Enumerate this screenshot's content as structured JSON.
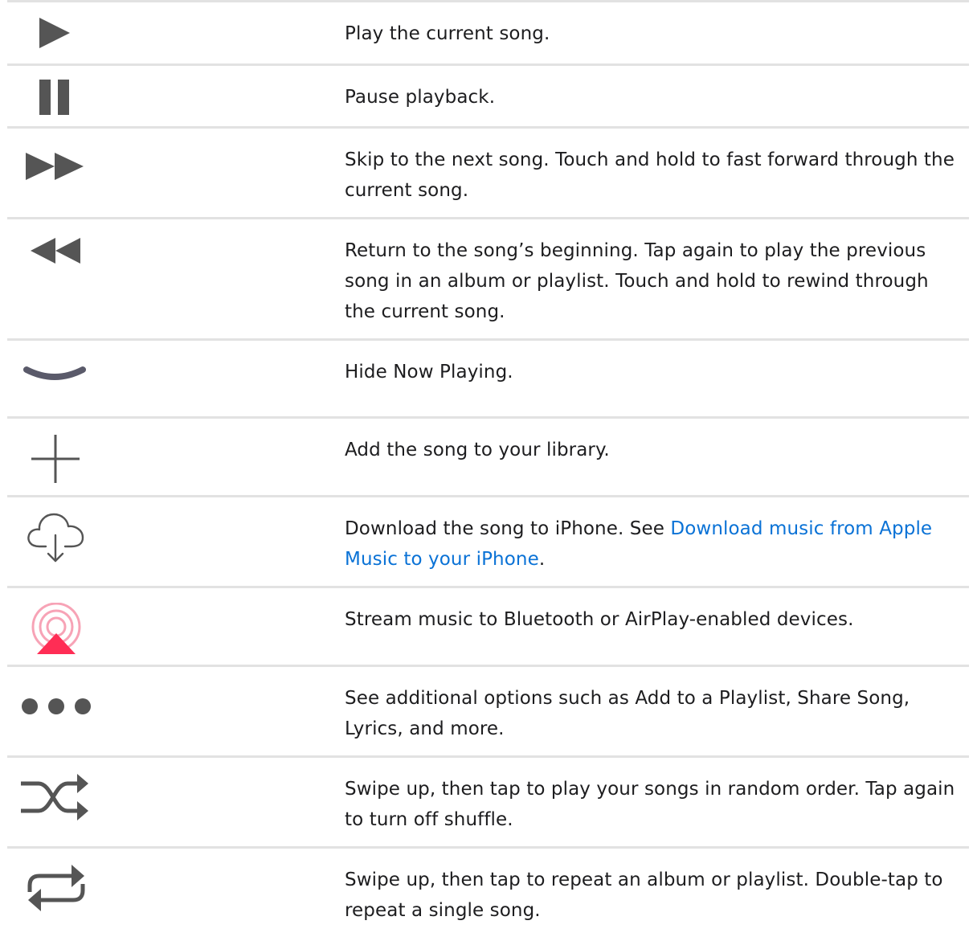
{
  "controls": [
    {
      "icon": "play-icon",
      "description": "Play the current song."
    },
    {
      "icon": "pause-icon",
      "description": "Pause playback."
    },
    {
      "icon": "fast-forward-icon",
      "description": "Skip to the next song. Touch and hold to fast forward through the current song."
    },
    {
      "icon": "rewind-icon",
      "description": "Return to the song’s beginning. Tap again to play the previous song in an album or playlist. Touch and hold to rewind through the current song."
    },
    {
      "icon": "chevron-down-icon",
      "description": "Hide Now Playing."
    },
    {
      "icon": "plus-icon",
      "description": "Add the song to your library."
    },
    {
      "icon": "cloud-download-icon",
      "description_before": "Download the song to iPhone. See ",
      "link_text": "Download music from Apple Music to your iPhone",
      "description_after": "."
    },
    {
      "icon": "airplay-icon",
      "description": "Stream music to Bluetooth or AirPlay-enabled devices."
    },
    {
      "icon": "more-icon",
      "description": "See additional options such as Add to a Playlist, Share Song, Lyrics, and more."
    },
    {
      "icon": "shuffle-icon",
      "description": "Swipe up, then tap to play your songs in random order. Tap again to turn off shuffle."
    },
    {
      "icon": "repeat-icon",
      "description": "Swipe up, then tap to repeat an album or playlist. Double-tap to repeat a single song."
    }
  ],
  "colors": {
    "icon_gray": "#555555",
    "airplay_pink": "#ff2d55",
    "airplay_rings": "#f7a3b6",
    "link_blue": "#0a72d6",
    "divider": "#e2e2e2"
  }
}
